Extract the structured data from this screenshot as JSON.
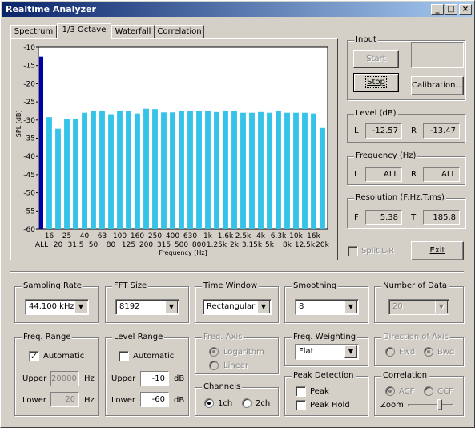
{
  "window": {
    "title": "Realtime Analyzer"
  },
  "tabs": [
    {
      "label": "Spectrum",
      "active": false
    },
    {
      "label": "1/3 Octave",
      "active": true
    },
    {
      "label": "Waterfall",
      "active": false
    },
    {
      "label": "Correlation",
      "active": false
    }
  ],
  "chart_data": {
    "type": "bar",
    "ylabel": "SPL [dB]",
    "xlabel": "Frequency [Hz]",
    "ylim": [
      -60,
      -10
    ],
    "yticks": [
      -10,
      -15,
      -20,
      -25,
      -30,
      -35,
      -40,
      -45,
      -50,
      -55,
      -60
    ],
    "bar_color": "#35c3ea",
    "all_bar_color": "#0000a8",
    "all_value": -12.57,
    "categories": [
      "16",
      "20",
      "25",
      "31.5",
      "40",
      "50",
      "63",
      "80",
      "100",
      "125",
      "160",
      "200",
      "250",
      "315",
      "400",
      "500",
      "630",
      "800",
      "1k",
      "1.25k",
      "1.6k",
      "2k",
      "2.5k",
      "3.15k",
      "4k",
      "5k",
      "6.3k",
      "8k",
      "10k",
      "12.5k",
      "16k",
      "20k"
    ],
    "xtick_top": [
      "16",
      "25",
      "40",
      "63",
      "100",
      "160",
      "250",
      "400",
      "630",
      "1k",
      "1.6k",
      "2.5k",
      "4k",
      "6.3k",
      "10k",
      "16k"
    ],
    "xtick_bottom": [
      "ALL",
      "20",
      "31.5",
      "50",
      "80",
      "125",
      "200",
      "315",
      "500",
      "800",
      "1.25k",
      "2k",
      "3.15k",
      "5k",
      "8k",
      "12.5k",
      "20k"
    ],
    "values": [
      -29.2,
      -32.4,
      -29.8,
      -29.8,
      -28.0,
      -27.4,
      -27.4,
      -28.4,
      -27.6,
      -27.6,
      -28.2,
      -26.9,
      -27.0,
      -27.9,
      -27.9,
      -27.4,
      -27.6,
      -27.6,
      -27.6,
      -27.8,
      -27.5,
      -27.5,
      -28.0,
      -28.0,
      -27.8,
      -28.0,
      -27.6,
      -28.0,
      -28.0,
      -28.0,
      -28.2,
      -32.2
    ]
  },
  "input": {
    "label": "Input",
    "start": "Start",
    "stop": "Stop",
    "calibration": "Calibration..."
  },
  "level": {
    "label": "Level (dB)",
    "l_label": "L",
    "l_value": "-12.57",
    "r_label": "R",
    "r_value": "-13.47"
  },
  "frequency": {
    "label": "Frequency (Hz)",
    "l_label": "L",
    "l_value": "ALL",
    "r_label": "R",
    "r_value": "ALL"
  },
  "resolution": {
    "label": "Resolution (F:Hz,T:ms)",
    "f_label": "F",
    "f_value": "5.38",
    "t_label": "T",
    "t_value": "185.8"
  },
  "split": {
    "label": "Split L-R"
  },
  "exit": {
    "label": "Exit"
  },
  "sampling_rate": {
    "label": "Sampling Rate",
    "value": "44.100 kHz"
  },
  "fft_size": {
    "label": "FFT Size",
    "value": "8192"
  },
  "time_window": {
    "label": "Time Window",
    "value": "Rectangular"
  },
  "smoothing": {
    "label": "Smoothing",
    "value": "8"
  },
  "number_of_data": {
    "label": "Number of Data",
    "value": "20"
  },
  "freq_range": {
    "label": "Freq. Range",
    "automatic": "Automatic",
    "upper_label": "Upper",
    "upper_value": "20000",
    "upper_unit": "Hz",
    "lower_label": "Lower",
    "lower_value": "20",
    "lower_unit": "Hz"
  },
  "level_range": {
    "label": "Level Range",
    "automatic": "Automatic",
    "upper_label": "Upper",
    "upper_value": "-10",
    "upper_unit": "dB",
    "lower_label": "Lower",
    "lower_value": "-60",
    "lower_unit": "dB"
  },
  "freq_axis": {
    "label": "Freq. Axis",
    "logarithm": "Logarithm",
    "linear": "Linear"
  },
  "freq_weighting": {
    "label": "Freq. Weighting",
    "value": "Flat"
  },
  "direction_of_axis": {
    "label": "Direction of Axis",
    "fwd": "Fwd",
    "bwd": "Bwd"
  },
  "channels": {
    "label": "Channels",
    "ch1": "1ch",
    "ch2": "2ch"
  },
  "peak_detection": {
    "label": "Peak Detection",
    "peak": "Peak",
    "peak_hold": "Peak Hold"
  },
  "correlation": {
    "label": "Correlation",
    "acf": "ACF",
    "ccf": "CCF",
    "zoom": "Zoom"
  }
}
